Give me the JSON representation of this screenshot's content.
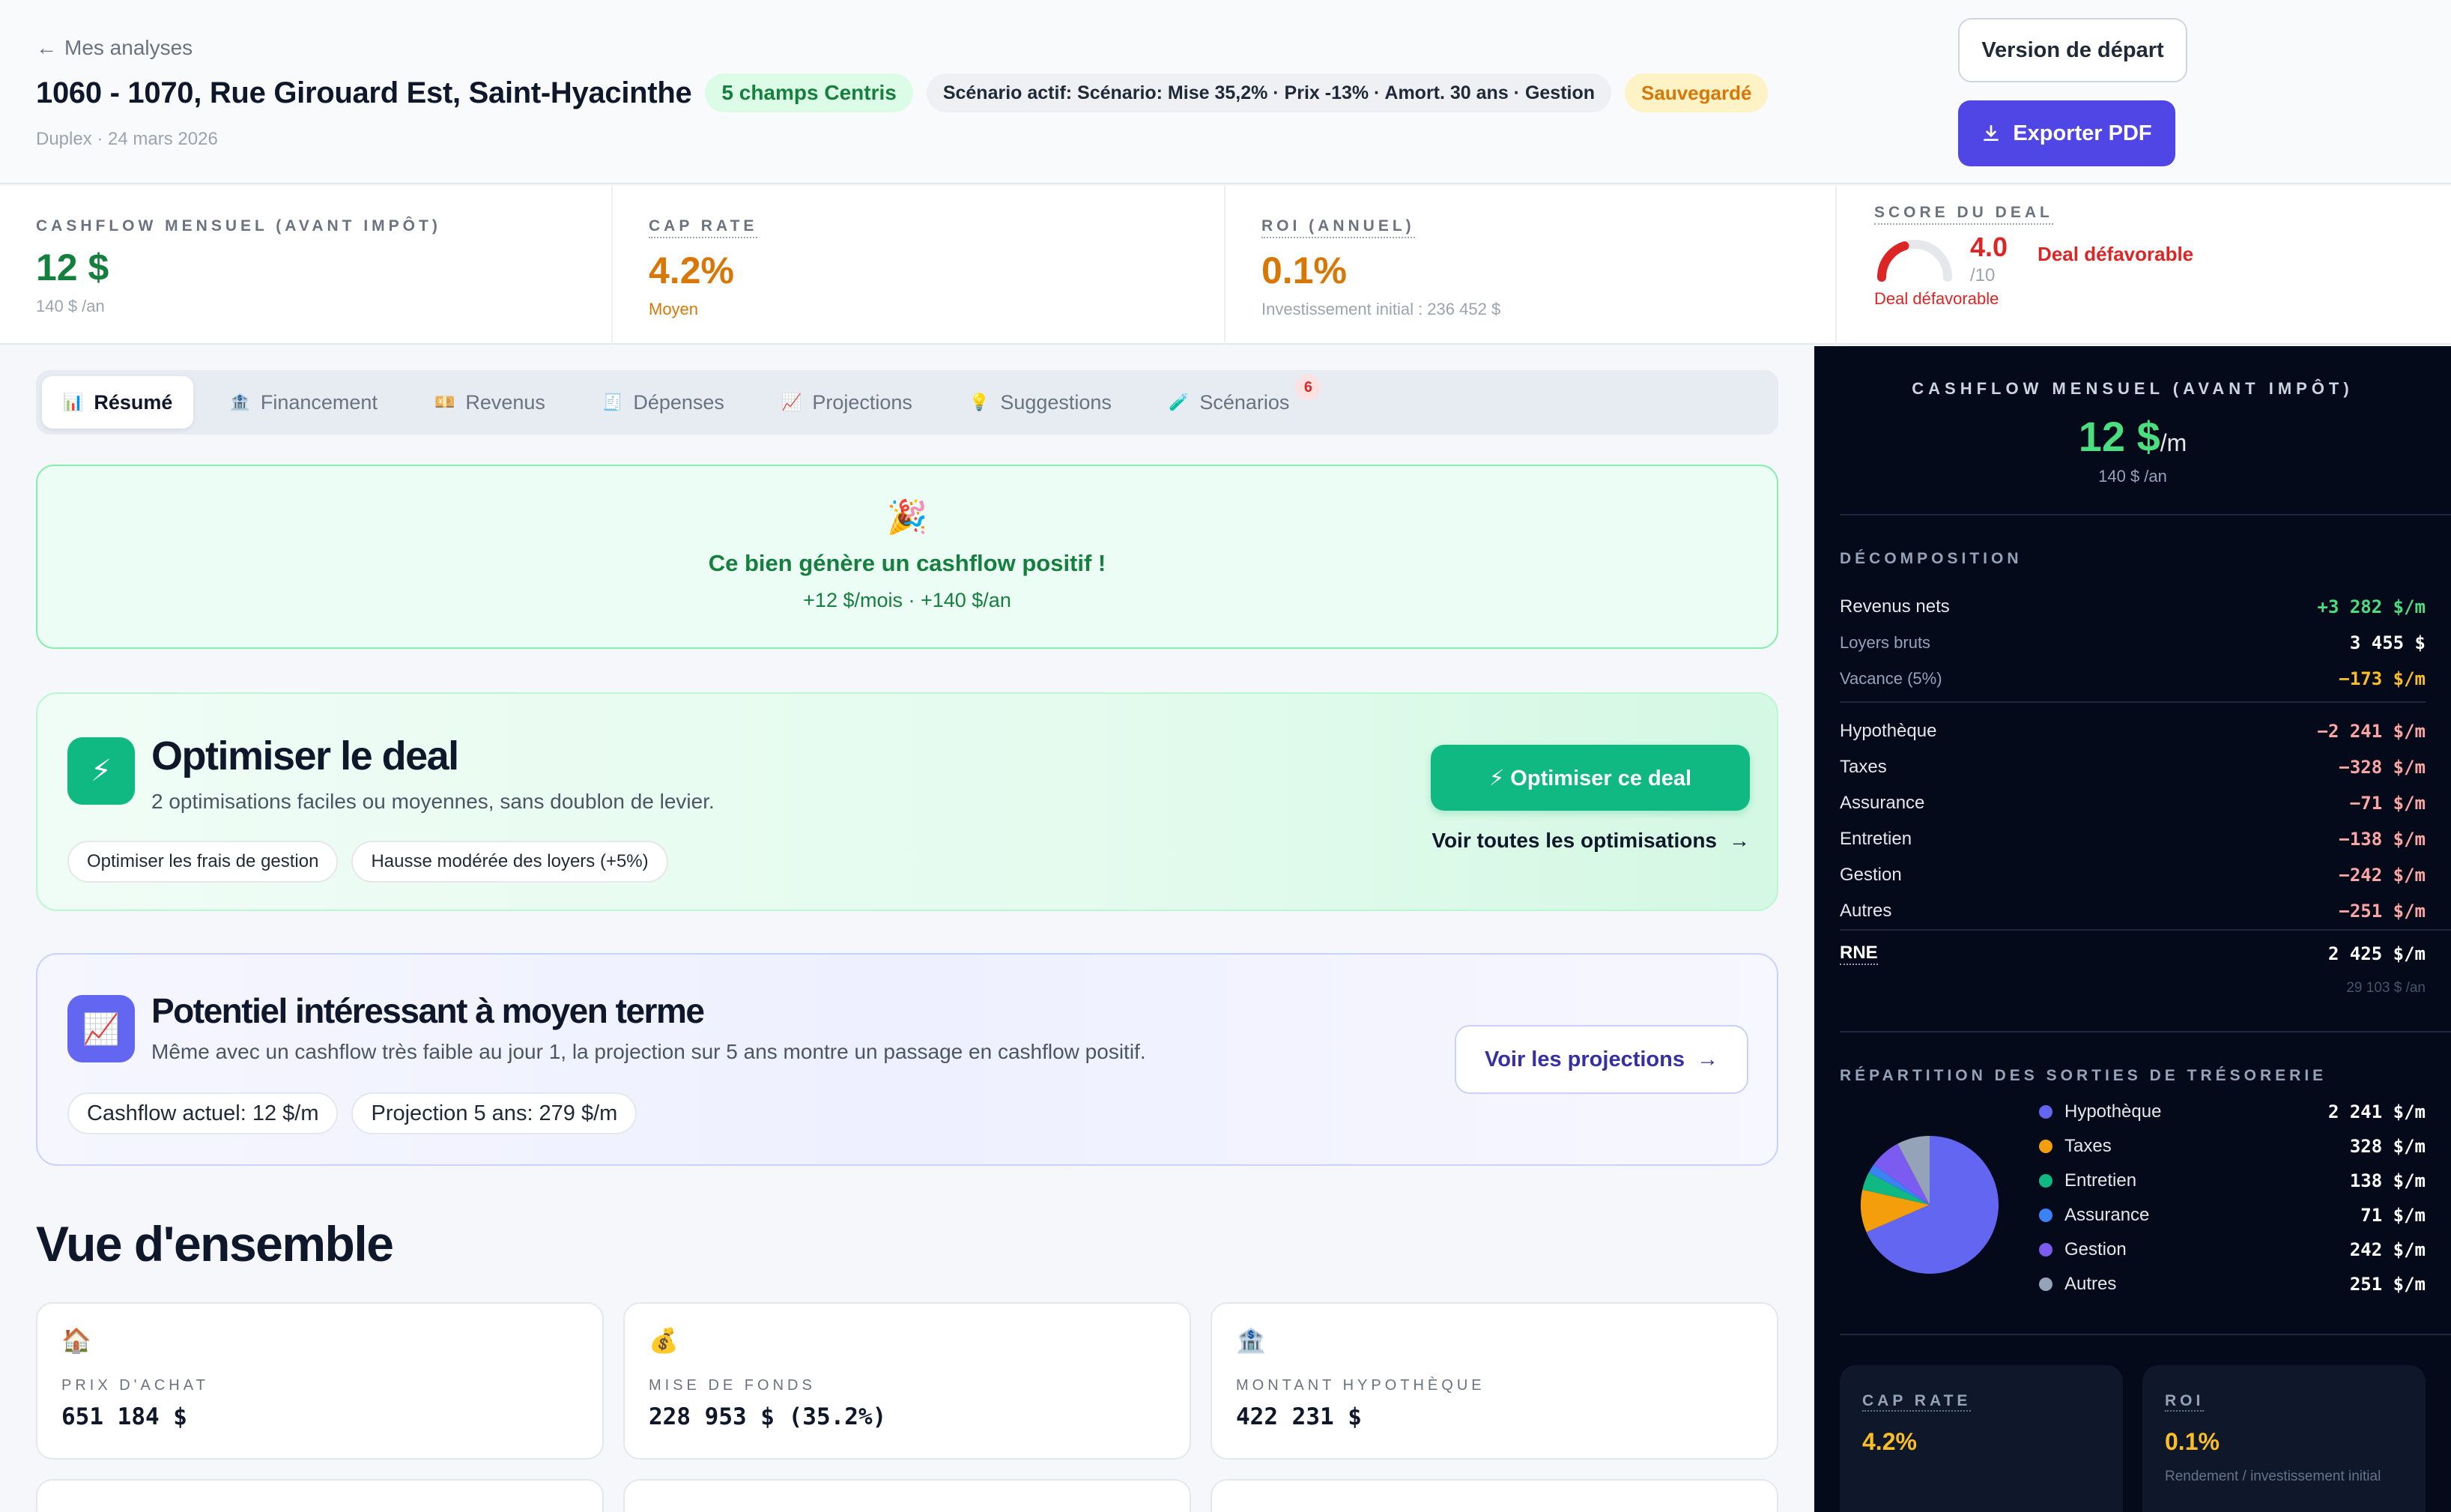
{
  "header": {
    "back_label": "Mes analyses",
    "title": "1060 - 1070, Rue Girouard Est, Saint-Hyacinthe",
    "centris_badge": "5 champs Centris",
    "scenario_badge": "Scénario actif: Scénario: Mise 35,2% · Prix -13% · Amort. 30 ans · Gestion",
    "saved_badge": "Sauvegardé",
    "subline": "Duplex · 24 mars 2026",
    "version_button": "Version de départ",
    "export_button": "Exporter PDF"
  },
  "kpis": {
    "cashflow": {
      "label": "CASHFLOW MENSUEL (AVANT IMPÔT)",
      "value": "12 $",
      "sub": "140 $ /an"
    },
    "cap_rate": {
      "label": "CAP RATE",
      "value": "4.2%",
      "sub": "Moyen"
    },
    "roi": {
      "label": "ROI (ANNUEL)",
      "value": "0.1%",
      "sub": "Investissement initial : 236 452 $"
    },
    "score": {
      "label": "SCORE DU DEAL",
      "value": "4.0",
      "den": "/10",
      "verdict": "Deal défavorable",
      "foot": "Deal défavorable",
      "fraction": 0.4
    }
  },
  "tabs": [
    {
      "icon": "📊",
      "label": "Résumé"
    },
    {
      "icon": "🏦",
      "label": "Financement"
    },
    {
      "icon": "💴",
      "label": "Revenus"
    },
    {
      "icon": "🧾",
      "label": "Dépenses"
    },
    {
      "icon": "📈",
      "label": "Projections"
    },
    {
      "icon": "💡",
      "label": "Suggestions"
    },
    {
      "icon": "🧪",
      "label": "Scénarios",
      "badge": "6"
    }
  ],
  "banner": {
    "icon": "🎉",
    "title": "Ce bien génère un cashflow positif !",
    "sub": "+12 $/mois · +140 $/an"
  },
  "optimize": {
    "icon": "⚡",
    "title": "Optimiser le deal",
    "desc": "2 optimisations faciles ou moyennes, sans doublon de levier.",
    "chips": [
      "Optimiser les frais de gestion",
      "Hausse modérée des loyers (+5%)"
    ],
    "button": "⚡ Optimiser ce deal",
    "link": "Voir toutes les optimisations"
  },
  "potential": {
    "icon": "📈",
    "title": "Potentiel intéressant à moyen terme",
    "desc": "Même avec un cashflow très faible au jour 1, la projection sur 5 ans montre un passage en cashflow positif.",
    "chips": [
      "Cashflow actuel: 12 $/m",
      "Projection 5 ans: 279 $/m"
    ],
    "button": "Voir les projections"
  },
  "overview": {
    "title": "Vue d'ensemble",
    "cards": [
      {
        "icon": "🏠",
        "label": "PRIX D'ACHAT",
        "value": "651 184 $"
      },
      {
        "icon": "💰",
        "label": "MISE DE FONDS",
        "value": "228 953 $ (35.2%)"
      },
      {
        "icon": "🏦",
        "label": "MONTANT HYPOTHÈQUE",
        "value": "422 231 $"
      }
    ]
  },
  "sidebar": {
    "head_label": "CASHFLOW MENSUEL (AVANT IMPÔT)",
    "head_value": "12 $",
    "head_unit": "/m",
    "head_sub": "140 $ /an",
    "decomp_label": "DÉCOMPOSITION",
    "decomp": [
      {
        "k": "Revenus nets",
        "v": "+3 282 $/m"
      },
      {
        "k": "Loyers bruts",
        "v": "3 455 $"
      },
      {
        "k": "Vacance (5%)",
        "v": "−173 $/m"
      },
      {
        "k": "Hypothèque",
        "v": "−2 241 $/m"
      },
      {
        "k": "Taxes",
        "v": "−328 $/m"
      },
      {
        "k": "Assurance",
        "v": "−71 $/m"
      },
      {
        "k": "Entretien",
        "v": "−138 $/m"
      },
      {
        "k": "Gestion",
        "v": "−242 $/m"
      },
      {
        "k": "Autres",
        "v": "−251 $/m"
      }
    ],
    "rne": {
      "k": "RNE",
      "v": "2 425 $/m",
      "sub": "29 103 $ /an"
    },
    "repartition_label": "RÉPARTITION DES SORTIES DE TRÉSORERIE",
    "repartition": [
      {
        "name": "Hypothèque",
        "value": 2241,
        "label": "2 241 $/m",
        "color": "#6366f1"
      },
      {
        "name": "Taxes",
        "value": 328,
        "label": "328 $/m",
        "color": "#f59e0b"
      },
      {
        "name": "Entretien",
        "value": 138,
        "label": "138 $/m",
        "color": "#10b981"
      },
      {
        "name": "Assurance",
        "value": 71,
        "label": "71 $/m",
        "color": "#3b82f6"
      },
      {
        "name": "Gestion",
        "value": 242,
        "label": "242 $/m",
        "color": "#7c5cf0"
      },
      {
        "name": "Autres",
        "value": 251,
        "label": "251 $/m",
        "color": "#94a3b8"
      }
    ],
    "mini_cap": {
      "label": "CAP RATE",
      "value": "4.2%"
    },
    "mini_roi": {
      "label": "ROI",
      "value": "0.1%",
      "sub": "Rendement / investissement initial"
    }
  }
}
